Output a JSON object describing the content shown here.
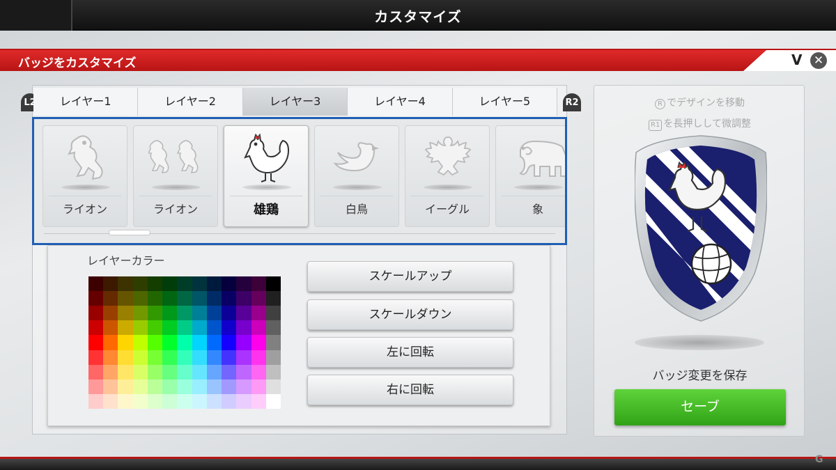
{
  "topbar": {
    "title": "カスタマイズ"
  },
  "header": {
    "title": "バッジをカスタマイズ",
    "collapse_glyph": "V",
    "close_glyph": "✕"
  },
  "shoulder_buttons": {
    "left": "L2",
    "right": "R2"
  },
  "tabs": [
    {
      "label": "レイヤー1",
      "active": false
    },
    {
      "label": "レイヤー2",
      "active": false
    },
    {
      "label": "レイヤー3",
      "active": true
    },
    {
      "label": "レイヤー4",
      "active": false
    },
    {
      "label": "レイヤー5",
      "active": false
    }
  ],
  "emblems": [
    {
      "label": "ライオン",
      "icon": "lion-rampant-icon",
      "active": false
    },
    {
      "label": "ライオン",
      "icon": "twin-lions-icon",
      "active": false
    },
    {
      "label": "雄鶏",
      "icon": "rooster-icon",
      "active": true
    },
    {
      "label": "白鳥",
      "icon": "swan-icon",
      "active": false
    },
    {
      "label": "イーグル",
      "icon": "eagle-icon",
      "active": false
    },
    {
      "label": "象",
      "icon": "elephant-icon",
      "active": false
    }
  ],
  "color_panel": {
    "title": "レイヤーカラー",
    "buttons": {
      "scale_up": "スケールアップ",
      "scale_down": "スケールダウン",
      "rotate_left": "左に回転",
      "rotate_right": "右に回転"
    }
  },
  "right_panel": {
    "hint_move_key": "R",
    "hint_move": "でデザインを移動",
    "hint_fine_key": "R1",
    "hint_fine": "を長押しして微調整",
    "save_caption": "バッジ変更を保存",
    "save_label": "セーブ"
  },
  "badge": {
    "primary_color": "#1a1f6e",
    "stripe_color": "#ffffff",
    "rim_color": "#c8ccd0"
  },
  "watermark": "G"
}
